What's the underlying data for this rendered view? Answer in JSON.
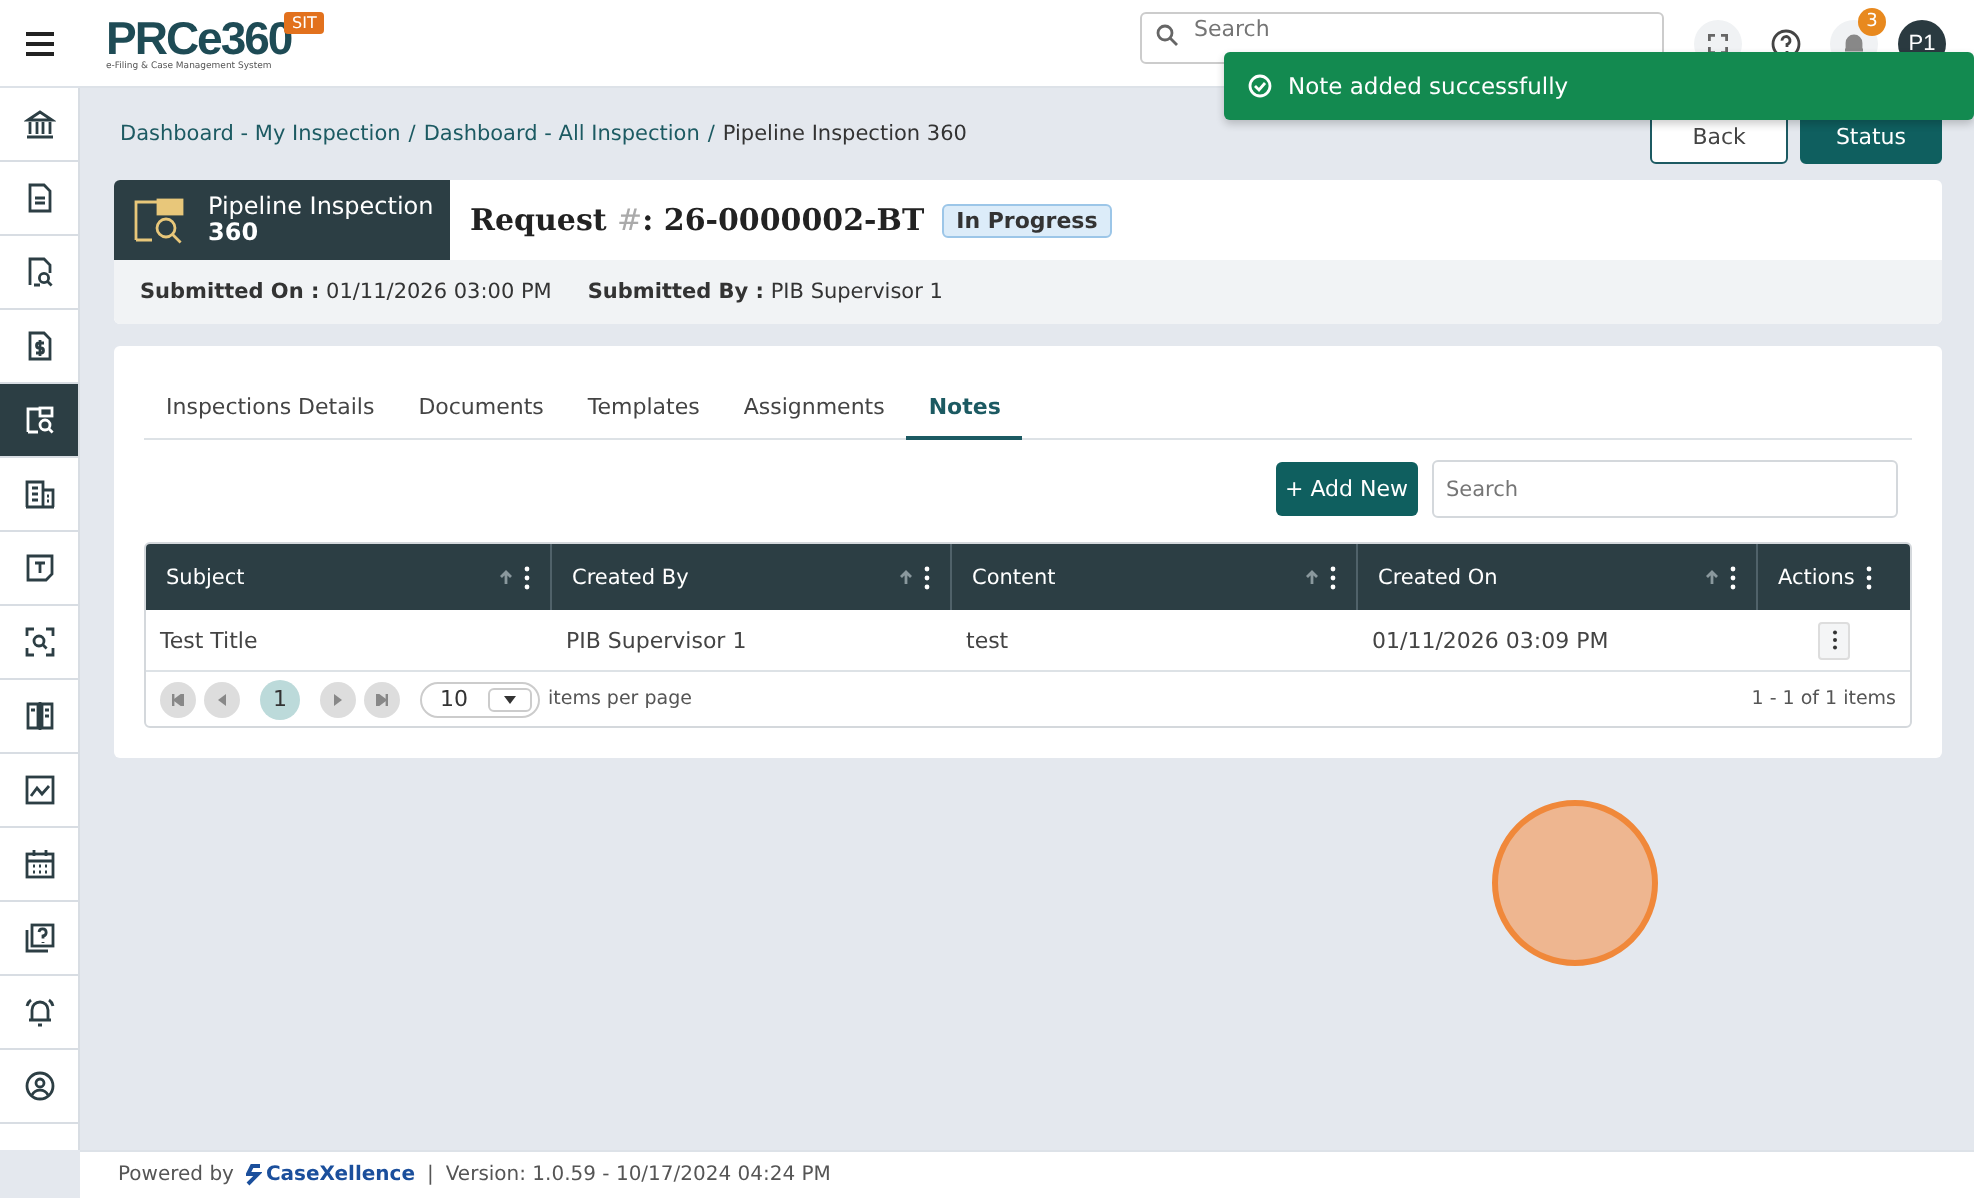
{
  "header": {
    "logo": "PRCe360",
    "logo_tagline": "e-Filing & Case Management System",
    "env_badge": "SIT",
    "search": {
      "placeholder": "Search"
    },
    "notification_count": "3",
    "avatar": "P1"
  },
  "toast": {
    "message": "Note added successfully"
  },
  "sidebar": {
    "items": [
      {
        "kind": "bank",
        "selected": false
      },
      {
        "kind": "document",
        "selected": false
      },
      {
        "kind": "document-search",
        "selected": false
      },
      {
        "kind": "document-dollar",
        "selected": false
      },
      {
        "kind": "inspection",
        "selected": true
      },
      {
        "kind": "building",
        "selected": false
      },
      {
        "kind": "text",
        "selected": false
      },
      {
        "kind": "scan",
        "selected": false
      },
      {
        "kind": "book",
        "selected": false
      },
      {
        "kind": "chart",
        "selected": false
      },
      {
        "kind": "calendar",
        "selected": false
      },
      {
        "kind": "help",
        "selected": false
      },
      {
        "kind": "alarm",
        "selected": false
      },
      {
        "kind": "user",
        "selected": false
      }
    ]
  },
  "breadcrumb": {
    "separator": "/",
    "items": [
      "Dashboard - My Inspection",
      "Dashboard - All Inspection",
      "Pipeline Inspection 360"
    ]
  },
  "actions": [
    "Back",
    "Status"
  ],
  "request": {
    "module": "Pipeline Inspection",
    "module_sub": "360",
    "title_prefix": "Request",
    "title_mark": "#",
    "title_number": ": 26-0000002-BT",
    "status": "In Progress"
  },
  "submitted": [
    "**Submitted On :** 01/11/2026 03:00 PM",
    "**Submitted By :** PIB Supervisor 1"
  ],
  "tabs": [
    {
      "label": "Inspections Details",
      "selected": false
    },
    {
      "label": "Documents",
      "selected": false
    },
    {
      "label": "Templates",
      "selected": false
    },
    {
      "label": "Assignments",
      "selected": false
    },
    {
      "label": "Notes",
      "selected": true
    }
  ],
  "add_button": "+ Add New",
  "table_search": {
    "placeholder": "Search"
  },
  "table": {
    "columns": [
      {
        "label": "Subject",
        "sortable": true
      },
      {
        "label": "Created By",
        "sortable": true
      },
      {
        "label": "Content",
        "sortable": true
      },
      {
        "label": "Created On",
        "sortable": true
      },
      {
        "label": "Actions",
        "sortable": false
      }
    ],
    "rows": [
      [
        "Test Title",
        "PIB Supervisor 1",
        "test",
        "01/11/2026 03:09 PM"
      ]
    ]
  },
  "pager": {
    "pages": [
      {
        "label": "1",
        "selected": true
      }
    ],
    "page_size": "10",
    "page_size_label": "items per page",
    "summary": "1 - 1 of 1 items"
  },
  "footer": {
    "powered_by": "Powered by",
    "brand": "CaseXellence",
    "separator": "|",
    "version": "Version: 1.0.59 - 10/17/2024 04:24 PM"
  }
}
